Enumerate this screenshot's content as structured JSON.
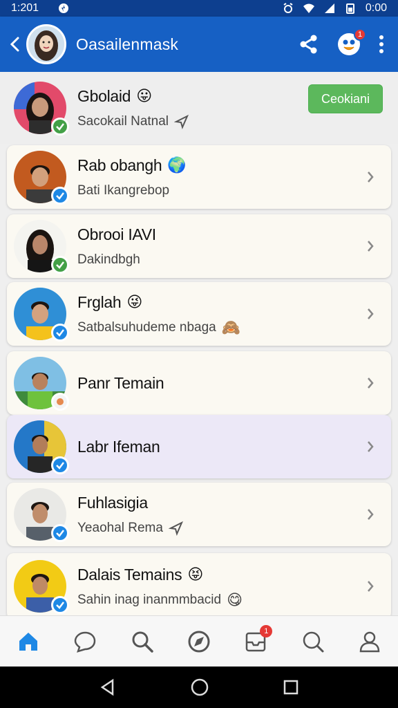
{
  "status": {
    "time_left": "1:201",
    "time_right": "0:00"
  },
  "header": {
    "title": "Oasailenmask"
  },
  "first_row": {
    "name": "Gbolaid",
    "name_emoji": "😛",
    "sub": "Sacokail Natnal",
    "action_label": "Ceokiani"
  },
  "rows": [
    {
      "name": "Rab obangh",
      "name_emoji": "🌍",
      "sub": "Bati Ikangrebop",
      "sub_emoji": ""
    },
    {
      "name": "Obrooi IAVI",
      "name_emoji": "",
      "sub": "Dakindbgh",
      "sub_emoji": ""
    },
    {
      "name": "Frglah",
      "name_emoji": "😜",
      "sub": "Satbalsuhudeme nbaga",
      "sub_emoji": "🙈"
    },
    {
      "name": "Panr Temain",
      "name_emoji": "",
      "sub": "",
      "sub_emoji": ""
    },
    {
      "name": "Labr Ifeman",
      "name_emoji": "",
      "sub": "",
      "sub_emoji": ""
    },
    {
      "name": "Fuhlasigia",
      "name_emoji": "",
      "sub": "Yeaohal Rema",
      "sub_emoji": ""
    },
    {
      "name": "Dalais Temains",
      "name_emoji": "😝",
      "sub": "Sahin inag inanmmbacid",
      "sub_emoji": "😋"
    }
  ],
  "badges": {
    "header_notification": "1",
    "nav_notification": "1"
  },
  "colors": {
    "appbar": "#1660c4",
    "statusbar": "#0d3f8f",
    "action_button": "#5cb85c",
    "verified": "#1e88e5",
    "online": "#43a047"
  }
}
